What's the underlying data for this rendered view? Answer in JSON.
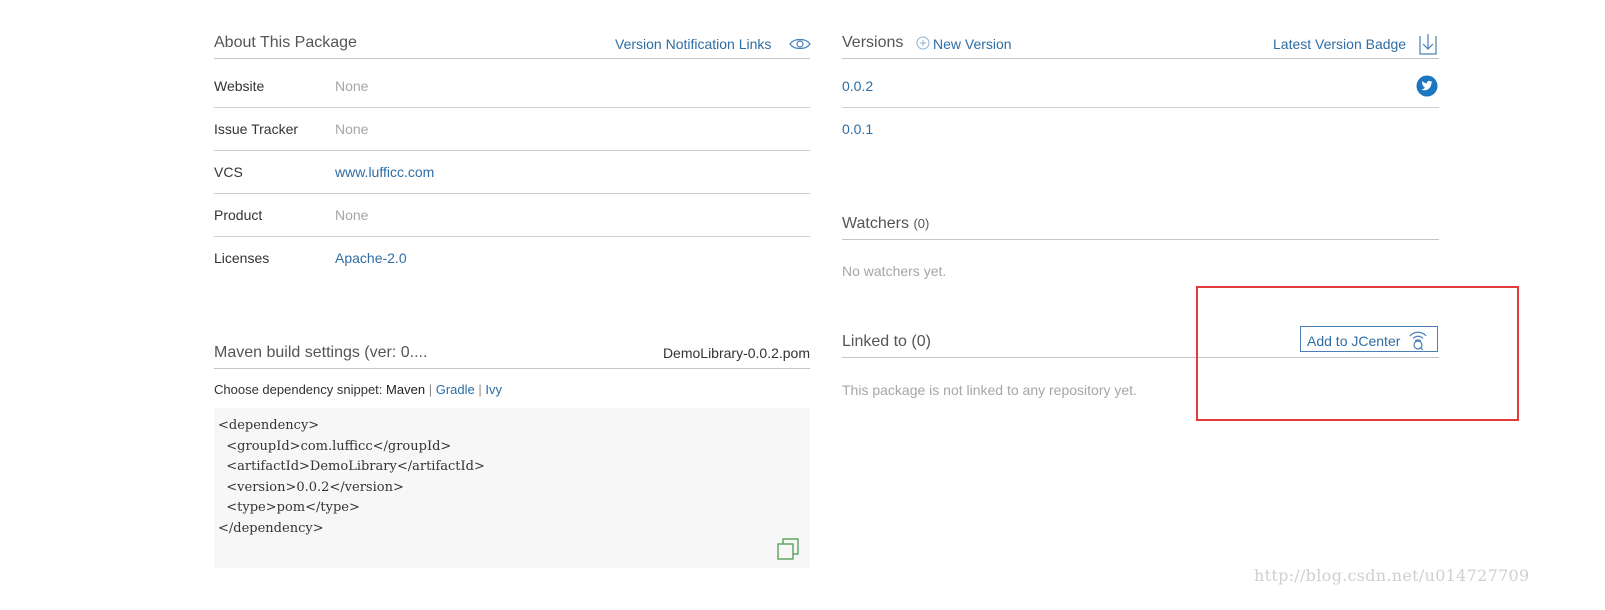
{
  "about": {
    "title": "About This Package",
    "notification_link": "Version Notification Links",
    "rows": [
      {
        "label": "Website",
        "value": "None"
      },
      {
        "label": "Issue Tracker",
        "value": "None"
      },
      {
        "label": "VCS",
        "value": "www.lufficc.com"
      },
      {
        "label": "Product",
        "value": "None"
      },
      {
        "label": "Licenses",
        "value": "Apache-2.0"
      }
    ]
  },
  "maven": {
    "title": "Maven build settings (ver: 0....",
    "pom_file": "DemoLibrary-0.0.2.pom",
    "snippet_prompt": "Choose dependency snippet:",
    "snippet_options": [
      "Maven",
      "Gradle",
      "Ivy"
    ],
    "snippet_separator": "|",
    "code": "<dependency>\n  <groupId>com.lufficc</groupId>\n  <artifactId>DemoLibrary</artifactId>\n  <version>0.0.2</version>\n  <type>pom</type>\n</dependency>"
  },
  "versions": {
    "title": "Versions",
    "new_version": "New Version",
    "badge_link": "Latest Version Badge",
    "items": [
      "0.0.2",
      "0.0.1"
    ]
  },
  "watchers": {
    "title": "Watchers",
    "count": "(0)",
    "empty_text": "No watchers yet."
  },
  "linked": {
    "title": "Linked to (0)",
    "add_button": "Add to JCenter",
    "empty_text": "This package is not linked to any repository yet."
  },
  "watermark": "http://blog.csdn.net/u014727709",
  "colors": {
    "link": "#2e6da4",
    "muted": "#a6a6a6",
    "twitter": "#1d76c0",
    "highlight_border": "#e33b3b",
    "code_bg": "#f7f7f7"
  },
  "icons": {
    "eye": "eye-icon",
    "plus_circle": "plus-circle-icon",
    "download_badge": "download-badge-icon",
    "twitter": "twitter-icon",
    "copy": "copy-icon",
    "jcenter": "jcenter-icon"
  }
}
